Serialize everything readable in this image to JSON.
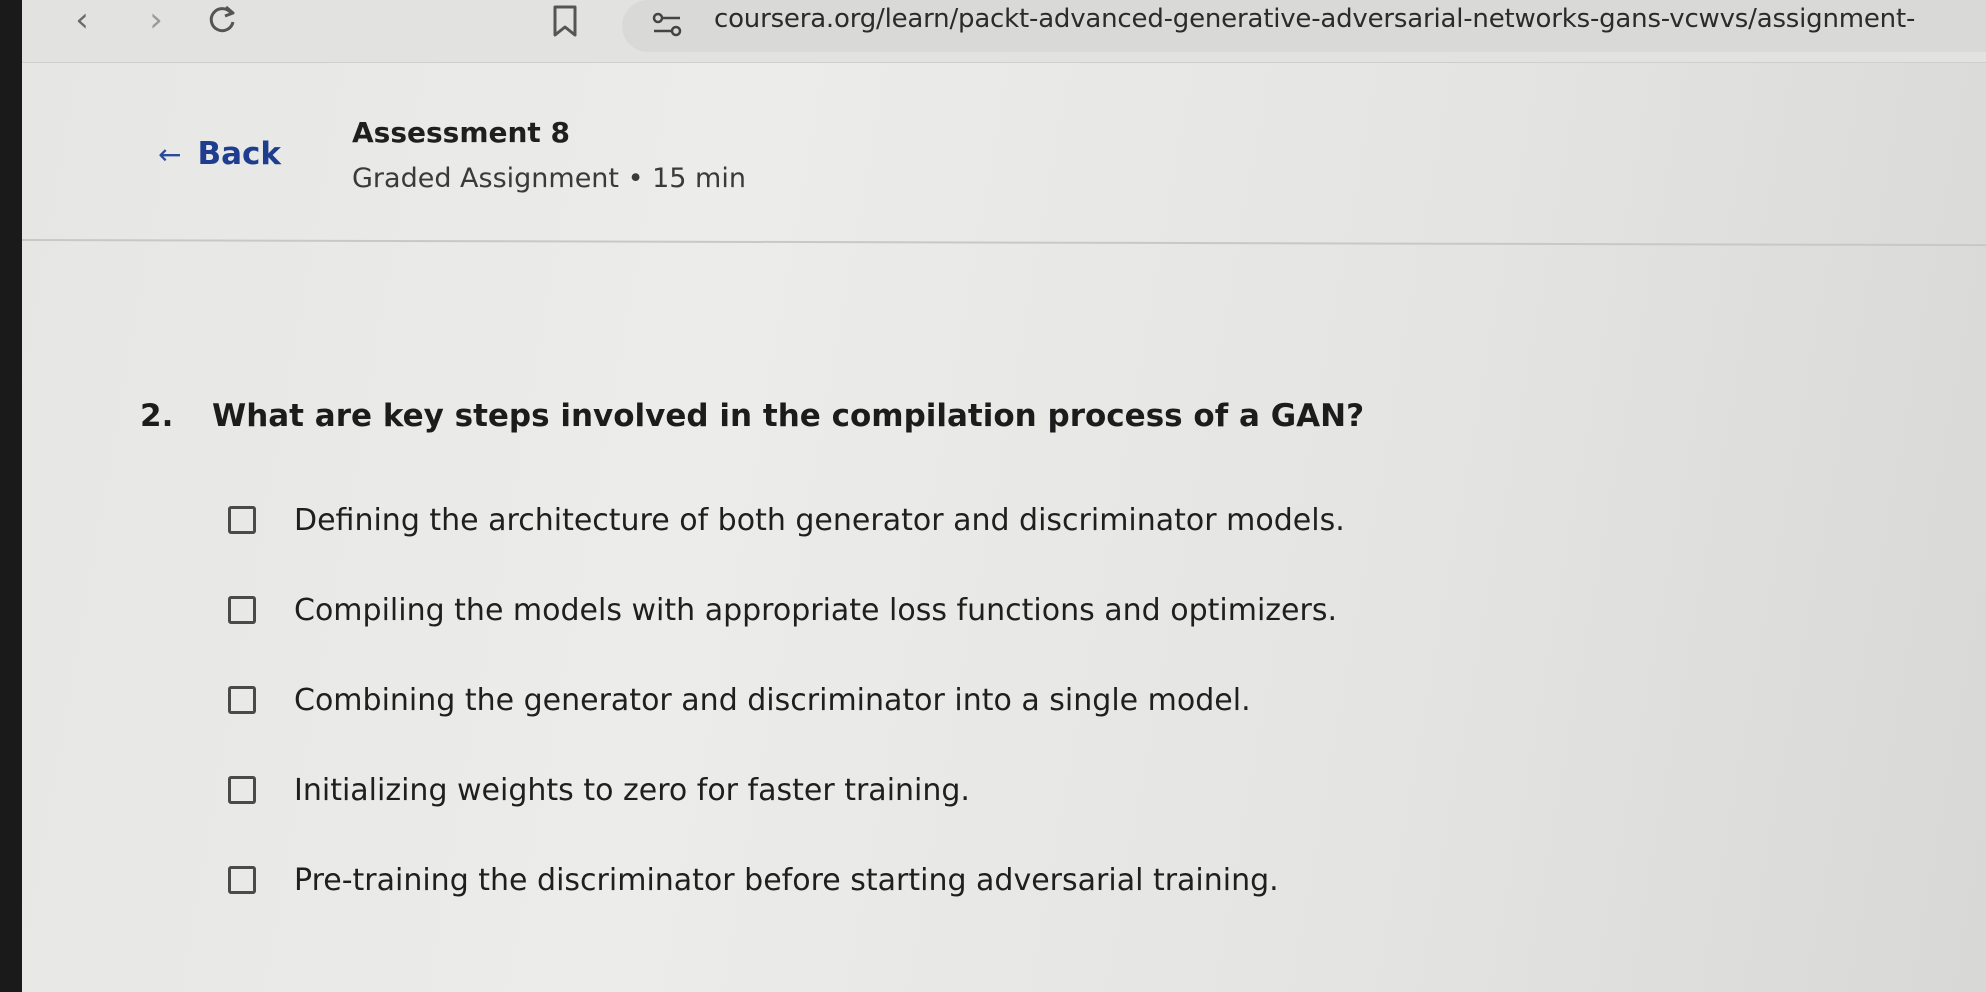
{
  "browser": {
    "url": "coursera.org/learn/packt-advanced-generative-adversarial-networks-gans-vcwvs/assignment-",
    "icons": {
      "back": "chevron-left-icon",
      "forward": "chevron-right-icon",
      "reload": "reload-icon",
      "bookmark": "bookmark-icon",
      "site_settings": "site-settings-icon"
    }
  },
  "header": {
    "back_label": "Back",
    "title": "Assessment 8",
    "subtitle": "Graded Assignment • 15 min",
    "accent_color": "#1f3d8f"
  },
  "question": {
    "number": "2.",
    "text": "What are key steps involved in the compilation process of a GAN?",
    "options": [
      {
        "label": "Defining the architecture of both generator and discriminator models.",
        "checked": false
      },
      {
        "label": "Compiling the models with appropriate loss functions and optimizers.",
        "checked": false
      },
      {
        "label": "Combining the generator and discriminator into a single model.",
        "checked": false
      },
      {
        "label": "Initializing weights to zero for faster training.",
        "checked": false
      },
      {
        "label": "Pre-training the discriminator before starting adversarial training.",
        "checked": false
      }
    ]
  }
}
